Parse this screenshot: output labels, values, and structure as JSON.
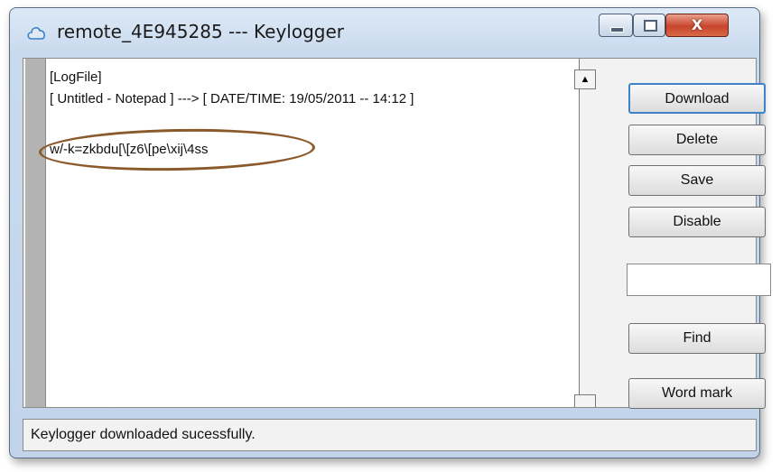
{
  "window": {
    "title": "remote_4E945285 --- Keylogger",
    "close_glyph": "X"
  },
  "log": {
    "lines": [
      "[LogFile]",
      "[ Untitled - Notepad ] ---> [ DATE/TIME: 19/05/2011 -- 14:12 ]",
      "w/-k=zkbdu[\\[z6\\[pe\\xij\\4ss"
    ],
    "scroll_up_glyph": "▲"
  },
  "buttons": {
    "download": "Download",
    "delete": "Delete",
    "save": "Save",
    "disable": "Disable",
    "find": "Find",
    "word_mark": "Word mark"
  },
  "find_input": {
    "value": ""
  },
  "status": {
    "text": "Keylogger downloaded sucessfully."
  },
  "colors": {
    "annotation_ellipse": "#8b5a2b",
    "default_button_border": "#3e83c9",
    "close_button": "#c8452c"
  },
  "icons": {
    "app": "cloud-icon",
    "minimize": "minimize-icon",
    "maximize": "maximize-icon",
    "close": "close-icon"
  }
}
